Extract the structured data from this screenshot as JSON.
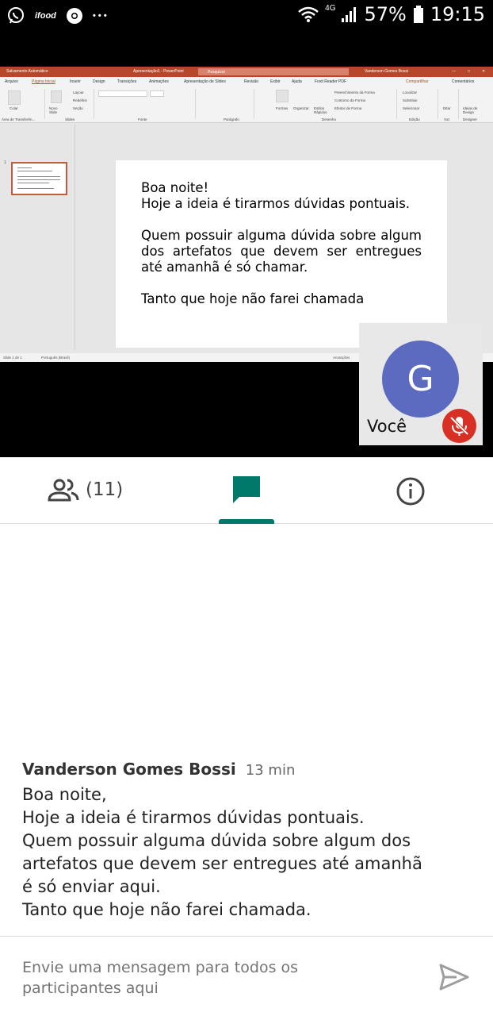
{
  "status_bar": {
    "app_icons": [
      "whatsapp-icon",
      "ifood-icon",
      "chrome-icon",
      "more-icon"
    ],
    "ifood_label": "ifood",
    "more_glyph": "• • •",
    "network": "4G",
    "battery": "57%",
    "time": "19:15"
  },
  "powerpoint": {
    "title_left": "Salvamento Automático",
    "title_center": "Apresentação1 - PowerPoint",
    "search_placeholder": "Pesquisar",
    "user": "Vanderson Gomes Bossi",
    "share": "Compartilhar",
    "comments": "Comentários",
    "tabs": [
      "Arquivo",
      "Página Inicial",
      "Inserir",
      "Design",
      "Transições",
      "Animações",
      "Apresentação de Slides",
      "Revisão",
      "Exibir",
      "Ajuda",
      "Foxit Reader PDF"
    ],
    "ribbon": {
      "paste": "Colar",
      "new_slide": "Novo Slide",
      "layout": "Layout",
      "reset": "Redefinir",
      "section": "Seção",
      "shapes": "Formas",
      "arrange": "Organizar",
      "quick_styles": "Estilos Rápidos",
      "shape_fill": "Preenchimento da Forma",
      "shape_outline": "Contorno da Forma",
      "shape_effects": "Efeitos de Forma",
      "find": "Localizar",
      "replace": "Substituir",
      "select": "Selecionar",
      "dictate": "Ditar",
      "design_ideas": "Ideias de Design",
      "groups": [
        "Área de Transferên...",
        "Slides",
        "Fonte",
        "Parágrafo",
        "Desenho",
        "Edição",
        "Voz",
        "Designer"
      ]
    },
    "slide_number": "1",
    "slide_text": {
      "line1": "Boa noite!",
      "line2": "Hoje a ideia é tirarmos dúvidas pontuais.",
      "para2": "Quem possuir alguma dúvida sobre algum dos artefatos que devem ser entregues até amanhã é só chamar.",
      "para3": "Tanto que hoje não farei chamada"
    },
    "status": {
      "slide_count": "Slide 1 de 1",
      "language": "Português (Brasil)",
      "notes": "Anotações"
    }
  },
  "self_view": {
    "initial": "G",
    "label": "Você",
    "mic_state": "muted",
    "avatar_color": "#5c6bc0",
    "mic_color": "#d93025"
  },
  "tabs": {
    "people_count": "(11)",
    "active_tab": "chat",
    "accent_color": "#00796b"
  },
  "chat": {
    "messages": [
      {
        "author": "Vanderson Gomes Bossi",
        "time": "13 min",
        "lines": [
          "Boa noite,",
          "Hoje a ideia é tirarmos dúvidas pontuais.",
          "Quem possuir alguma dúvida sobre algum dos",
          "artefatos que devem ser entregues até amanhã",
          "é só enviar aqui.",
          "Tanto que hoje não farei chamada."
        ]
      }
    ]
  },
  "composer": {
    "placeholder": "Envie uma mensagem para todos os participantes aqui"
  }
}
